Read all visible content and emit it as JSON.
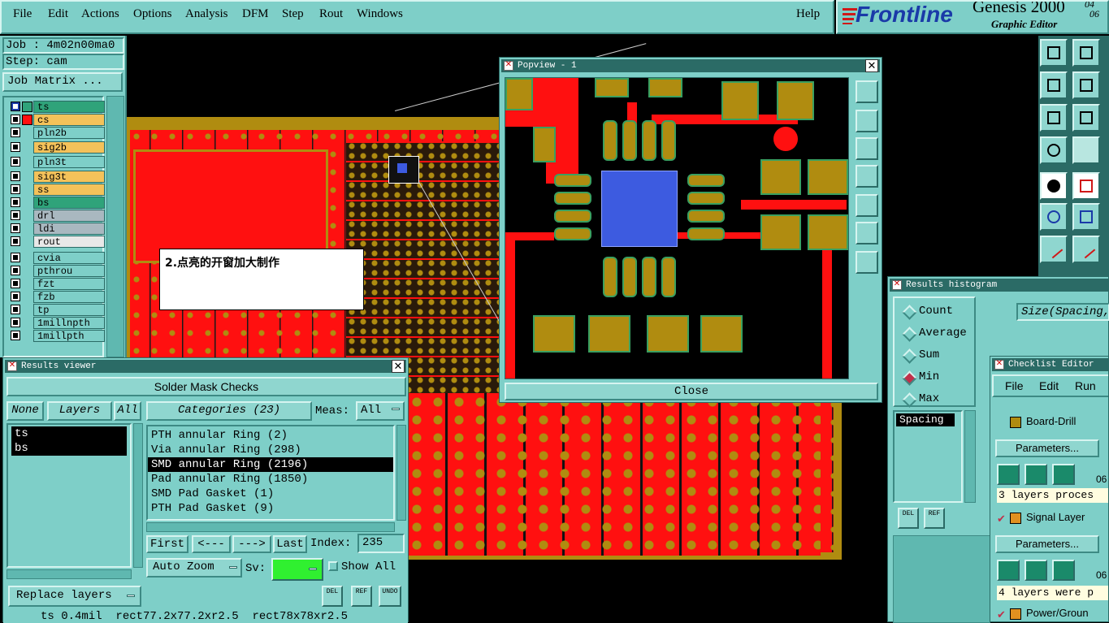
{
  "menu": {
    "file": "File",
    "edit": "Edit",
    "actions": "Actions",
    "options": "Options",
    "analysis": "Analysis",
    "dfm": "DFM",
    "step": "Step",
    "rout": "Rout",
    "windows": "Windows",
    "help": "Help"
  },
  "brand": {
    "logo": "Frontline",
    "product": "Genesis 2000",
    "subtitle": "Graphic Editor",
    "version_top": "04",
    "version_bottom": "06"
  },
  "job_panel": {
    "job": "Job : 4m02n00ma0",
    "step": "Step: cam",
    "matrix_button": "Job Matrix ..."
  },
  "layers": [
    {
      "name": "ts",
      "color": "#2fa37a",
      "checked": true
    },
    {
      "name": "cs",
      "color": "#f4c25a",
      "checked": false
    },
    {
      "name": "pln2b",
      "color": "#7ecfc8",
      "checked": false
    },
    {
      "name": "sig2b",
      "color": "#f4c25a",
      "checked": false
    },
    {
      "name": "pln3t",
      "color": "#7ecfc8",
      "checked": false
    },
    {
      "name": "sig3t",
      "color": "#f4c25a",
      "checked": false
    },
    {
      "name": "ss",
      "color": "#f4c25a",
      "checked": false
    },
    {
      "name": "bs",
      "color": "#2fa37a",
      "checked": false
    },
    {
      "name": "drl",
      "color": "#a9b8c0",
      "checked": false
    },
    {
      "name": "ldi",
      "color": "#a9b8c0",
      "checked": false
    },
    {
      "name": "rout",
      "color": "#e8e8e8",
      "checked": false
    },
    {
      "name": "cvia",
      "color": "#7ecfc8",
      "checked": false
    },
    {
      "name": "pthrou",
      "color": "#7ecfc8",
      "checked": false
    },
    {
      "name": "fzt",
      "color": "#7ecfc8",
      "checked": false
    },
    {
      "name": "fzb",
      "color": "#7ecfc8",
      "checked": false
    },
    {
      "name": "tp",
      "color": "#7ecfc8",
      "checked": false
    },
    {
      "name": "1millnpth",
      "color": "#7ecfc8",
      "checked": false
    },
    {
      "name": "1millpth",
      "color": "#7ecfc8",
      "checked": false
    }
  ],
  "annotation": {
    "text": "2.点亮的开窗加大制作"
  },
  "popview": {
    "title": "Popview - 1",
    "close": "Close"
  },
  "results_viewer": {
    "title": "Results viewer",
    "header": "Solder Mask Checks",
    "none": "None",
    "layers": "Layers",
    "all": "All",
    "categories": "Categories (23)",
    "meas_label": "Meas:",
    "meas_value": "All",
    "layer_items": [
      "ts",
      "bs"
    ],
    "category_items": [
      "PTH annular Ring (2)",
      "Via annular Ring (298)",
      "SMD annular Ring (2196)",
      "Pad annular Ring (1850)",
      "SMD Pad Gasket (1)",
      "PTH Pad Gasket (9)"
    ],
    "selected_category": 2,
    "first": "First",
    "prev": "<---",
    "next": "--->",
    "last": "Last",
    "index_label": "Index:",
    "index_value": "235",
    "auto_zoom": "Auto Zoom",
    "sv_label": "Sv:",
    "show_all": "Show All",
    "replace_layers": "Replace layers",
    "del": "DEL",
    "ref": "REF",
    "undo": "UNDO",
    "status": "ts 0.4mil  rect77.2x77.2xr2.5  rect78x78xr2.5"
  },
  "histogram": {
    "title": "Results histogram",
    "options": [
      "Count",
      "Average",
      "Sum",
      "Min",
      "Max"
    ],
    "selected": "Min",
    "field": "Size(Spacing,",
    "list_item": "Spacing",
    "del": "DEL",
    "ref": "REF"
  },
  "checklist": {
    "title": "Checklist Editor",
    "menu": [
      "File",
      "Edit",
      "Run"
    ],
    "row1": "Board-Drill",
    "params": "Parameters...",
    "date1": "06",
    "msg1": "3 layers proces",
    "row2": "Signal Layer",
    "msg2": "4 layers were p",
    "row3": "Power/Groun",
    "date2": "06"
  },
  "colors": {
    "bg": "#000000",
    "panel": "#7ecfc8",
    "copper": "#ff1010",
    "pad": "#b08c10",
    "selected": "#000000"
  }
}
